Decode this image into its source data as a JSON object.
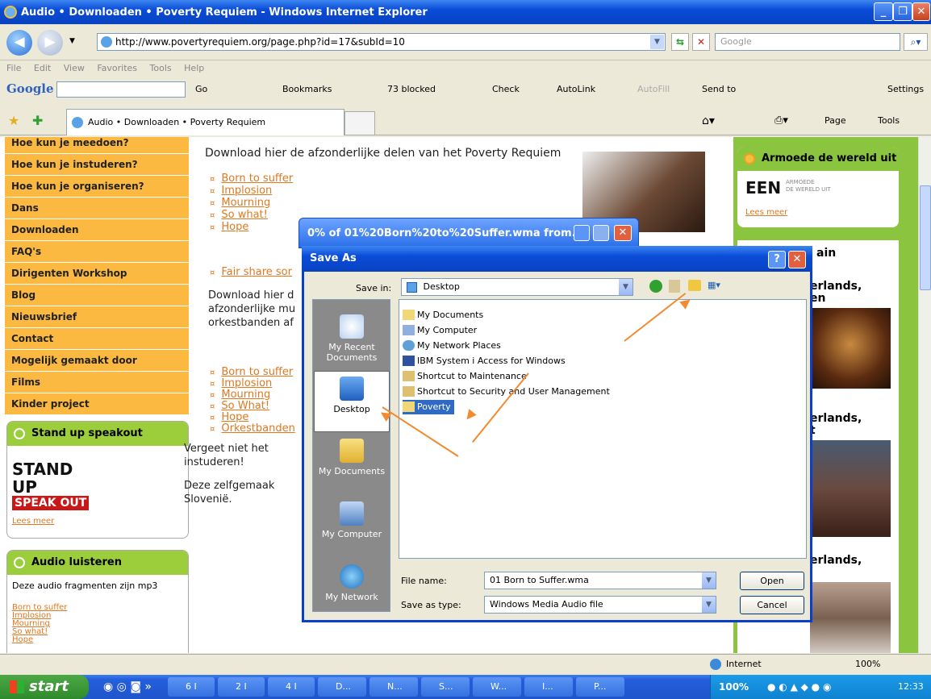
{
  "window": {
    "title": "Audio • Downloaden • Poverty Requiem - Windows Internet Explorer"
  },
  "address": {
    "url": "http://www.povertyrequiem.org/page.php?id=17&subId=10",
    "search_placeholder": "Google"
  },
  "menu": [
    "File",
    "Edit",
    "View",
    "Favorites",
    "Tools",
    "Help"
  ],
  "google_toolbar": {
    "go": "Go",
    "bookmarks": "Bookmarks",
    "blocked": "73 blocked",
    "check": "Check",
    "autolink": "AutoLink",
    "autofill": "AutoFill",
    "sendto": "Send to",
    "settings": "Settings"
  },
  "tabbar": {
    "tab_label": "Audio • Downloaden • Poverty Requiem",
    "page": "Page",
    "tools": "Tools"
  },
  "leftnav": {
    "items": [
      "Hoe kun je meedoen?",
      "Hoe kun je instuderen?",
      "Hoe kun je organiseren?",
      "Dans",
      "Downloaden",
      "FAQ's",
      "Dirigenten Workshop",
      "Blog",
      "Nieuwsbrief",
      "Contact",
      "Mogelijk gemaakt door",
      "Films",
      "Kinder project"
    ],
    "standup": {
      "title": "Stand up speakout",
      "logo_line1": "STAND UP",
      "logo_line2": "SPEAK OUT",
      "more": "Lees meer"
    },
    "audio": {
      "title": "Audio luisteren",
      "text": "Deze audio fragmenten zijn mp3",
      "links": [
        "Born to suffer",
        "Implosion",
        "Mourning",
        "So what!",
        "Hope"
      ]
    }
  },
  "content": {
    "intro": "Download hier de afzonderlijke delen van het Poverty Requiem",
    "list1": [
      "Born to suffer",
      "Implosion",
      "Mourning",
      "So what!",
      "Hope"
    ],
    "fairshare": "Fair share sor",
    "para1_a": "Download hier d",
    "para1_b": "afzonderlijke mu",
    "para1_c": "orkestbanden af",
    "list2": [
      "Born to suffer",
      "Implosion",
      "Mourning",
      "So What!",
      "Hope",
      "Orkestbanden"
    ],
    "para2_a": "Vergeet niet het",
    "para2_b": "instuderen!",
    "para3_a": "Deze zelfgemaak",
    "para3_b": "Slovenië."
  },
  "rightcol": {
    "box1_title": "Armoede de wereld uit",
    "logo": "EEN",
    "logo_sub1": "ARMOEDE",
    "logo_sub2": "DE WERELD UIT",
    "more": "Lees meer",
    "h_ain": "ain",
    "h1_a": "erlands,",
    "h1_b": "en",
    "h2_a": "erlands,",
    "h2_b": "t",
    "h3_a": "erlands,"
  },
  "progress_dialog": {
    "title": "0% of 01%20Born%20to%20Suffer.wma from..."
  },
  "saveas": {
    "title": "Save As",
    "savein_label": "Save in:",
    "savein_value": "Desktop",
    "places": [
      "My Recent Documents",
      "Desktop",
      "My Documents",
      "My Computer",
      "My Network"
    ],
    "files": [
      "My Documents",
      "My Computer",
      "My Network Places",
      "IBM System i Access for Windows",
      "Shortcut to Maintenance",
      "Shortcut to Security and User Management",
      "Poverty"
    ],
    "filename_label": "File name:",
    "filename_value": "01 Born to Suffer.wma",
    "type_label": "Save as type:",
    "type_value": "Windows Media Audio file",
    "open": "Open",
    "cancel": "Cancel"
  },
  "statusbar": {
    "zone": "Internet",
    "zoom": "100%"
  },
  "taskbar": {
    "start": "start",
    "items": [
      "6 I",
      "2 I",
      "4 I",
      "D...",
      "N...",
      "S...",
      "W...",
      "I...",
      "P..."
    ],
    "tray_pct": "100%",
    "clock": "12:33"
  },
  "colors": {
    "nav_orange": "#fcb941",
    "green": "#8bc43e",
    "link": "#e07820",
    "xp_blue": "#0a4cd8"
  }
}
